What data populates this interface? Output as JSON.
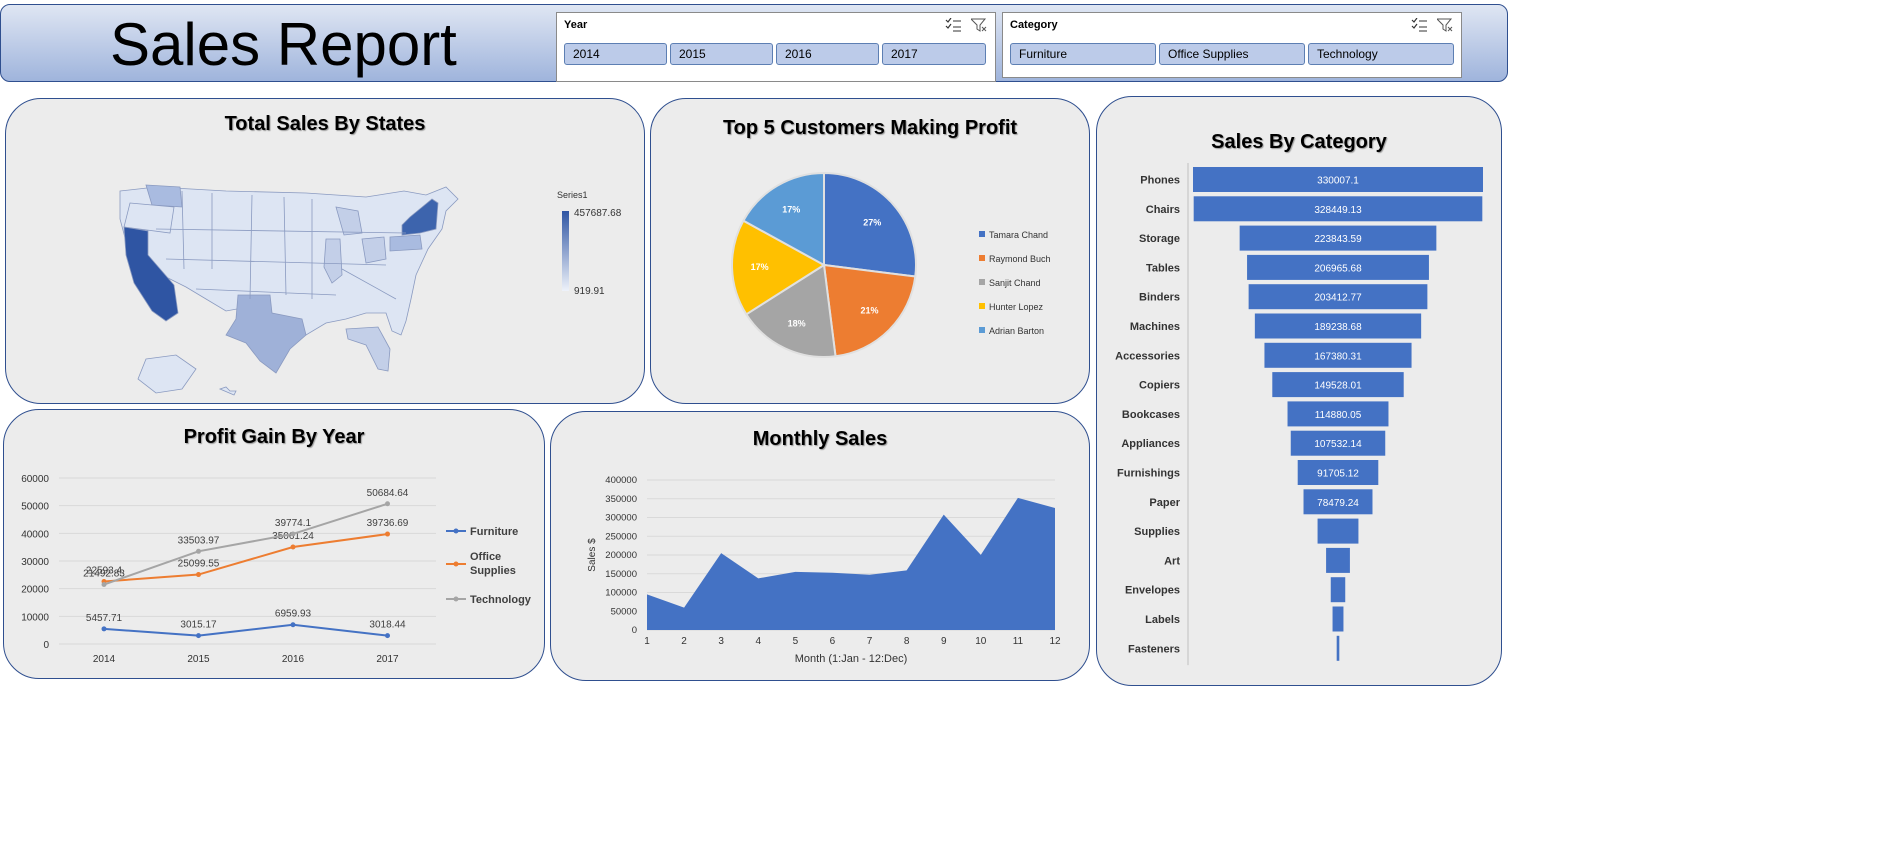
{
  "header": {
    "title": "Sales Report"
  },
  "slicers": {
    "year": {
      "label": "Year",
      "items": [
        "2014",
        "2015",
        "2016",
        "2017"
      ]
    },
    "category": {
      "label": "Category",
      "items": [
        "Furniture",
        "Office Supplies",
        "Technology"
      ]
    }
  },
  "panels": {
    "map_title": "Total Sales By States",
    "pie_title": "Top 5 Customers Making Profit",
    "funnel_title": "Sales By Category",
    "profit_title": "Profit Gain By Year",
    "monthly_title": "Monthly Sales"
  },
  "colors": {
    "blue": "#4472c4",
    "orange": "#ed7d31",
    "gray": "#a5a5a5",
    "yellow": "#ffc000",
    "light_blue": "#5b9bd5",
    "panel_border": "#2f4f8f"
  },
  "chart_data": [
    {
      "type": "heatmap",
      "title": "Total Sales By States",
      "legend": {
        "series": "Series1",
        "max_label": "457687.68",
        "min_label": "919.91"
      },
      "map": "USA states"
    },
    {
      "type": "pie",
      "title": "Top 5 Customers Making Profit",
      "legend_position": "right",
      "slices": [
        {
          "name": "Tamara Chand",
          "label": "27%",
          "value": 27
        },
        {
          "name": "Raymond Buch",
          "label": "21%",
          "value": 21
        },
        {
          "name": "Sanjit Chand",
          "label": "18%",
          "value": 18
        },
        {
          "name": "Hunter Lopez",
          "label": "17%",
          "value": 17
        },
        {
          "name": "Adrian Barton",
          "label": "17%",
          "value": 17
        }
      ]
    },
    {
      "type": "bar",
      "orientation": "funnel",
      "title": "Sales By Category",
      "categories": [
        "Phones",
        "Chairs",
        "Storage",
        "Tables",
        "Binders",
        "Machines",
        "Accessories",
        "Copiers",
        "Bookcases",
        "Appliances",
        "Furnishings",
        "Paper",
        "Supplies",
        "Art",
        "Envelopes",
        "Labels",
        "Fasteners"
      ],
      "values": [
        330007.1,
        328449.13,
        223843.59,
        206965.68,
        203412.77,
        189238.68,
        167380.31,
        149528.01,
        114880.05,
        107532.14,
        91705.12,
        78479.24,
        46500,
        27100,
        16500,
        12400,
        3000
      ],
      "labels": [
        "330007.1",
        "328449.13",
        "223843.59",
        "206965.68",
        "203412.77",
        "189238.68",
        "167380.31",
        "149528.01",
        "114880.05",
        "107532.14",
        "91705.12",
        "78479.24",
        "",
        "",
        "",
        "",
        ""
      ]
    },
    {
      "type": "line",
      "title": "Profit Gain By Year",
      "categories": [
        "2014",
        "2015",
        "2016",
        "2017"
      ],
      "yticks": [
        "0",
        "10000",
        "20000",
        "30000",
        "40000",
        "50000",
        "60000"
      ],
      "ylim": [
        0,
        60000
      ],
      "legend_position": "right",
      "series": [
        {
          "name": "Furniture",
          "values": [
            5457.71,
            3015.17,
            6959.93,
            3018.44
          ],
          "labels": [
            "5457.71",
            "3015.17",
            "6959.93",
            "3018.44"
          ]
        },
        {
          "name": "Office Supplies",
          "values": [
            22593.4,
            25099.55,
            35061.24,
            39736.69
          ],
          "labels": [
            "22593.4",
            "25099.55",
            "35061.24",
            "39736.69"
          ]
        },
        {
          "name": "Technology",
          "values": [
            21492.83,
            33503.97,
            39774.1,
            50684.64
          ],
          "labels": [
            "21492.83",
            "33503.97",
            "39774.1",
            "50684.64"
          ]
        }
      ]
    },
    {
      "type": "area",
      "title": "Monthly Sales",
      "xlabel": "Month (1:Jan - 12:Dec)",
      "ylabel": "Sales $",
      "x": [
        1,
        2,
        3,
        4,
        5,
        6,
        7,
        8,
        9,
        10,
        11,
        12
      ],
      "values": [
        94920,
        59751,
        205005,
        137762,
        155029,
        152718,
        147238,
        159044,
        307650,
        200323,
        352461,
        325293
      ],
      "yticks": [
        "0",
        "50000",
        "100000",
        "150000",
        "200000",
        "250000",
        "300000",
        "350000",
        "400000"
      ],
      "ylim": [
        0,
        400000
      ]
    }
  ]
}
